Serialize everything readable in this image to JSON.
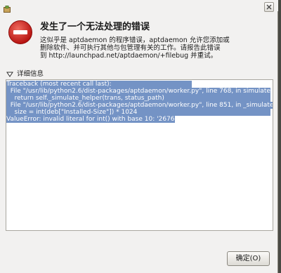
{
  "window": {
    "icon": "package-icon",
    "close_icon": "close-icon"
  },
  "dialog": {
    "icon": "error-icon",
    "heading": "发生了一个无法处理的错误",
    "message_lines": [
      "这似乎是 aptdaemon 的程序错误，aptdaemon 允许您添加或",
      "删除软件、并可执行其他与包管理有关的工作。请报告此错误",
      "到 http://launchpad.net/aptdaemon/+filebug 并重试。"
    ],
    "details_label": "详细信息",
    "details_expanded": true,
    "traceback_lines": [
      "Traceback (most recent call last):",
      "  File \"/usr/lib/python2.6/dist-packages/aptdaemon/worker.py\", line 768, in simulate",
      "    return self._simulate_helper(trans, status_path)",
      "  File \"/usr/lib/python2.6/dist-packages/aptdaemon/worker.py\", line 851, in _simulate_helper",
      "    size = int(deb[\"Installed-Size\"]) * 1024",
      "ValueError: invalid literal for int() with base 10: '2676.082'"
    ],
    "ok_button": "确定(O)"
  },
  "colors": {
    "selection": "#7493c5",
    "error_red": "#d11f1f"
  }
}
